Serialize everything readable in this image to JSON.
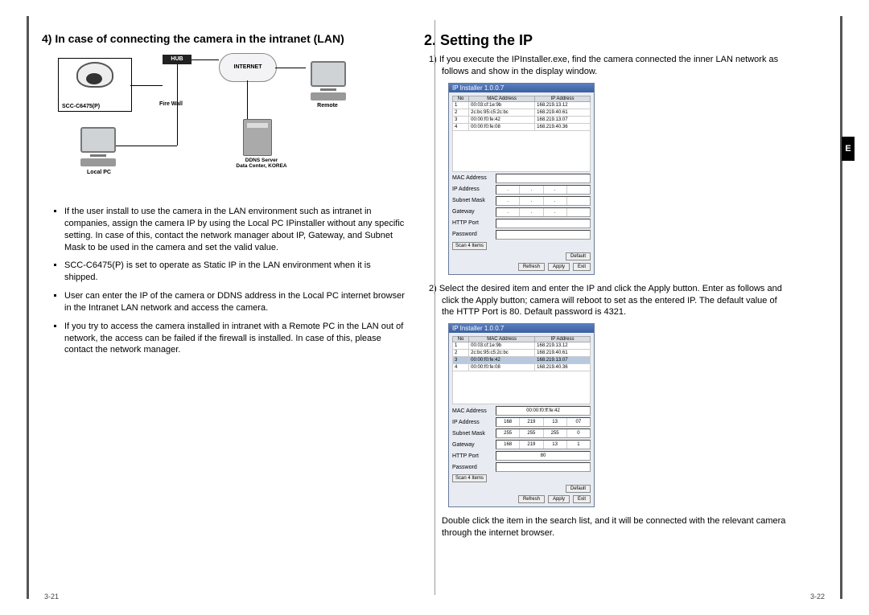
{
  "left": {
    "heading": "4) In case of connecting the camera in the intranet (LAN)",
    "diagram": {
      "camera_model": "SCC-C6475(P)",
      "hub": "HUB",
      "internet": "INTERNET",
      "firewall": "Fire Wall",
      "local_pc": "Local PC",
      "remote": "Remote",
      "ddns1": "DDNS Server",
      "ddns2": "Data Center, KOREA"
    },
    "bullets": [
      "If the user install to use the camera in the LAN environment such as intranet in companies, assign the camera IP by using the Local PC IPinstaller without any specific setting. In case of this, contact the network manager about IP, Gateway, and Subnet Mask to be used in the camera and set the valid value.",
      "SCC-C6475(P) is set to operate as Static IP in the LAN environment when it is shipped.",
      "User can enter the IP of the camera or DDNS address in the Local PC internet browser in the Intranet LAN network and access the camera.",
      "If you try to access the camera installed in intranet with a Remote PC in the LAN out of network, the access can be failed if the firewall is installed. In case of this, please contact the network manager."
    ],
    "page_num": "3-21"
  },
  "right": {
    "heading": "2. Setting the IP",
    "step1": "1) If you execute the IPInstaller.exe, find the camera connected the inner LAN network as follows and show in the display window.",
    "step2": "2) Select the desired item and enter the IP and click the Apply button. Enter as follows and click the Apply button; camera will reboot to set as the entered IP. The default value of the HTTP Port is 80. Default password is 4321.",
    "footer_note": "Double click the item in the search list, and it will be connected with the relevant camera through the internet browser.",
    "page_num": "3-22",
    "side_tab": "E",
    "installer": {
      "title": "IP Installer 1.0.0.7",
      "cols": {
        "no": "No",
        "mac": "MAC Address",
        "ip": "IP Address"
      },
      "rows": [
        {
          "no": "1",
          "mac": "00:03:cf:1e:9b",
          "ip": "168.219.13.12"
        },
        {
          "no": "2",
          "mac": "2c:bc:95:c5:2c:bc",
          "ip": "168.219.40.61"
        },
        {
          "no": "3",
          "mac": "00:00:f0:fe:42",
          "ip": "168.219.13.07"
        },
        {
          "no": "4",
          "mac": "00:00:f0:fe:08",
          "ip": "168.219.40.36"
        }
      ],
      "labels": {
        "mac": "MAC Address",
        "ip": "IP Address",
        "mask": "Subnet Mask",
        "gw": "Gateway",
        "http": "HTTP Port",
        "pw": "Password"
      },
      "scan": "Scan 4 Items",
      "btn_refresh": "Refresh",
      "btn_apply": "Apply",
      "btn_exit": "Exit",
      "btn_default": "Default",
      "filled": {
        "mac": "00:00:f0:ff:fe:42",
        "ip": [
          "168",
          "219",
          "13",
          "07"
        ],
        "mask": [
          "255",
          "255",
          "255",
          "0"
        ],
        "gw": [
          "168",
          "219",
          "13",
          "1"
        ],
        "http": "80"
      }
    }
  }
}
